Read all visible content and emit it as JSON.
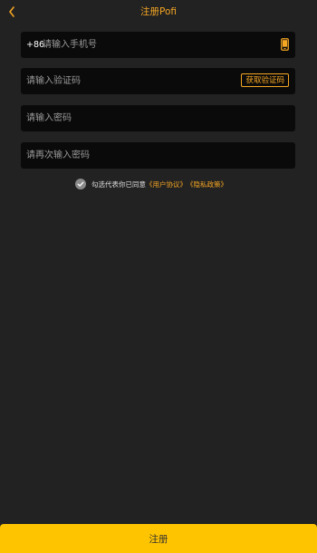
{
  "header": {
    "title": "注册Pofi",
    "back_icon": "chevron-left-icon"
  },
  "form": {
    "phone": {
      "prefix": "+86",
      "placeholder": "请输入手机号",
      "value": "",
      "icon": "phone-icon"
    },
    "code": {
      "placeholder": "请输入验证码",
      "value": "",
      "button_label": "获取验证码"
    },
    "password": {
      "placeholder": "请输入密码",
      "value": ""
    },
    "confirm_password": {
      "placeholder": "请再次输入密码",
      "value": ""
    }
  },
  "agreement": {
    "checked": true,
    "text": "勾选代表你已同意",
    "user_agreement": "《用户协议》",
    "privacy_policy": "《隐私政策》"
  },
  "register_button": {
    "label": "注册"
  },
  "colors": {
    "background": "#222222",
    "field_background": "#0a0a0a",
    "accent": "#f5a623",
    "button": "#ffc400"
  }
}
